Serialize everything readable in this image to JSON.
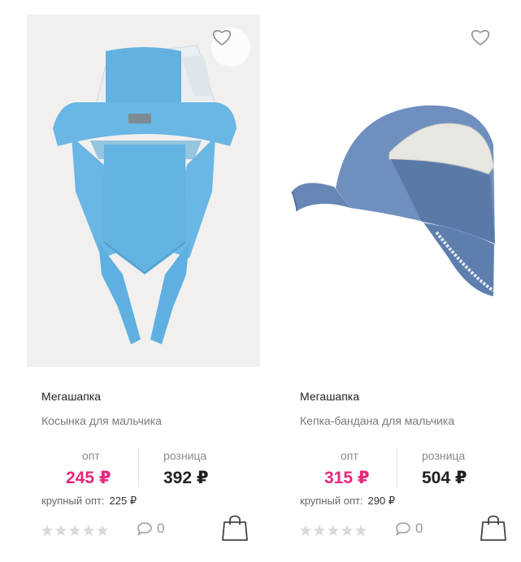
{
  "products": [
    {
      "brand": "Мегашапка",
      "name": "Косынка для мальчика",
      "price_labels": {
        "wholesale": "опт",
        "retail": "розница"
      },
      "wholesale_price": "245 ₽",
      "retail_price": "392 ₽",
      "bulk_label": "крупный опт:",
      "bulk_price": "225 ₽",
      "comments_count": "0",
      "rating_stars": 0,
      "icons": [
        "heart-icon",
        "star-icon",
        "comment-icon",
        "shopping-bag-icon"
      ]
    },
    {
      "brand": "Мегашапка",
      "name": "Кепка-бандана для мальчика",
      "price_labels": {
        "wholesale": "опт",
        "retail": "розница"
      },
      "wholesale_price": "315 ₽",
      "retail_price": "504 ₽",
      "bulk_label": "крупный опт:",
      "bulk_price": "290 ₽",
      "comments_count": "0",
      "rating_stars": 0,
      "icons": [
        "heart-icon",
        "star-icon",
        "comment-icon",
        "shopping-bag-icon"
      ]
    }
  ],
  "colors": {
    "wholesale_price": "#e6287d",
    "retail_price": "#1f1f1f",
    "star_empty": "#d9d9d9"
  }
}
